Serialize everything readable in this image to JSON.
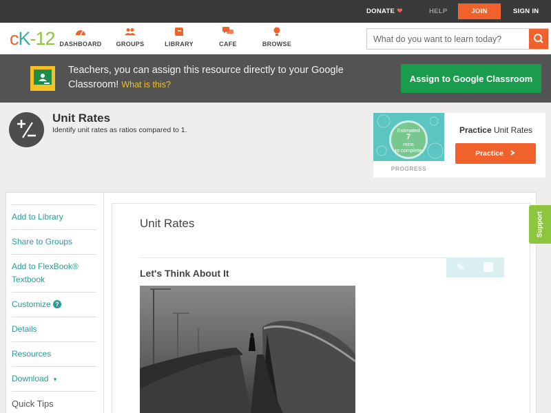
{
  "topbar": {
    "donate": "DONATE",
    "help": "HELP",
    "join": "JOIN",
    "signin": "SIGN IN"
  },
  "logo": {
    "c": "c",
    "k": "K",
    "dash": "-",
    "num": "12"
  },
  "nav": {
    "items": [
      {
        "label": "DASHBOARD",
        "icon": "dashboard-icon"
      },
      {
        "label": "GROUPS",
        "icon": "groups-icon"
      },
      {
        "label": "LIBRARY",
        "icon": "library-icon"
      },
      {
        "label": "CAFE",
        "icon": "cafe-icon"
      },
      {
        "label": "BROWSE",
        "icon": "browse-icon"
      }
    ],
    "search_placeholder": "What do you want to learn today?"
  },
  "banner": {
    "text": "Teachers, you can assign this resource directly to your Google Classroom!",
    "link": "What is this?",
    "button": "Assign to Google Classroom"
  },
  "module": {
    "title": "Unit Rates",
    "subtitle": "Identify unit rates as ratios compared to 1."
  },
  "practice": {
    "est_line1": "Estimated",
    "est_value": "7",
    "est_line2": "mins",
    "est_line3": "to complete",
    "progress_label": "PROGRESS",
    "title_bold": "Practice",
    "title_rest": "Unit Rates",
    "button": "Practice"
  },
  "sidebar": {
    "items": [
      {
        "label": "Add to Library"
      },
      {
        "label": "Share to Groups"
      },
      {
        "label": "Add to FlexBook® Textbook"
      },
      {
        "label": "Customize",
        "help": "?"
      },
      {
        "label": "Details"
      },
      {
        "label": "Resources"
      },
      {
        "label": "Download",
        "caret": "▾"
      },
      {
        "label": "Quick Tips"
      }
    ]
  },
  "lesson": {
    "title": "Unit Rates",
    "section": "Let's Think About It"
  },
  "support": "Support",
  "colors": {
    "brand_orange": "#f0612b",
    "brand_teal": "#2a9c96",
    "google_green": "#1a9c4d",
    "support_green": "#8cc63f"
  }
}
